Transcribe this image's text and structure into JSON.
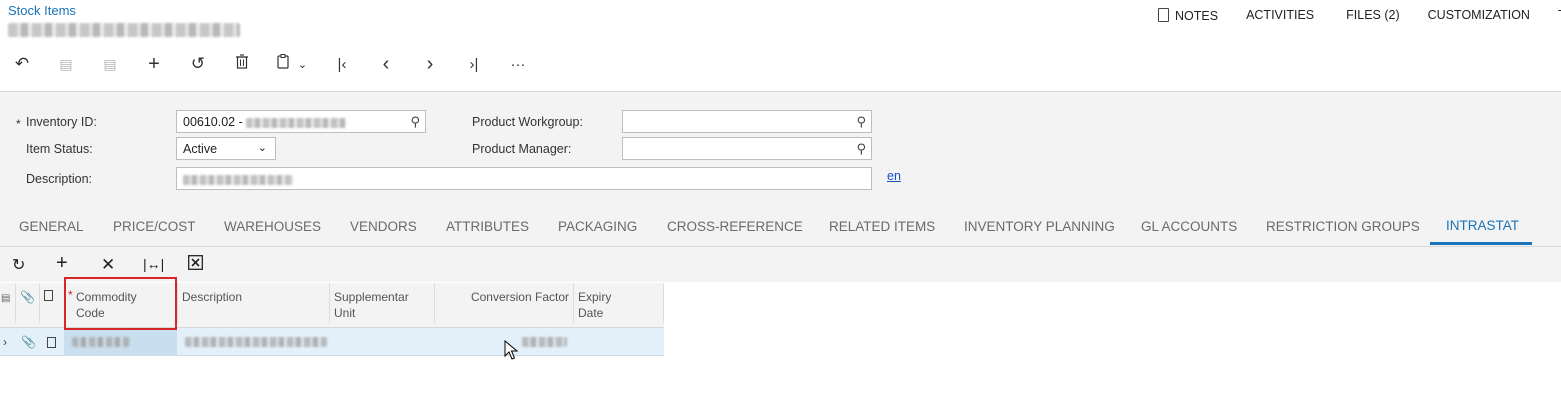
{
  "header": {
    "screen_title": "Stock Items",
    "links": [
      "NOTES",
      "ACTIVITIES",
      "FILES (2)",
      "CUSTOMIZATION",
      "TO"
    ]
  },
  "toolbar": {
    "back": "↶",
    "cancel": "⟲",
    "save": "🖫",
    "add": "+",
    "undo": "↶",
    "delete": "🗑",
    "copy": "⎘",
    "copy_arrow": "⌄",
    "first": "|<",
    "prev": "<",
    "next": ">",
    "last": ">|",
    "more": "···"
  },
  "form": {
    "inventory_id_label": "Inventory ID:",
    "inventory_id_value": "00610.02 -",
    "item_status_label": "Item Status:",
    "item_status_value": "Active",
    "description_label": "Description:",
    "product_workgroup_label": "Product Workgroup:",
    "product_manager_label": "Product Manager:",
    "language_link": "en",
    "required_mark": "*"
  },
  "tabs": [
    {
      "label": "GENERAL"
    },
    {
      "label": "PRICE/COST"
    },
    {
      "label": "WAREHOUSES"
    },
    {
      "label": "VENDORS"
    },
    {
      "label": "ATTRIBUTES"
    },
    {
      "label": "PACKAGING"
    },
    {
      "label": "CROSS-REFERENCE"
    },
    {
      "label": "RELATED ITEMS"
    },
    {
      "label": "INVENTORY PLANNING"
    },
    {
      "label": "GL ACCOUNTS"
    },
    {
      "label": "RESTRICTION GROUPS"
    },
    {
      "label": "INTRASTAT"
    }
  ],
  "active_tab": "INTRASTAT",
  "grid": {
    "columns": {
      "commodity_code": "Commodity Code",
      "description": "Description",
      "supplementary_unit": "Supplementar Unit",
      "conversion_factor": "Conversion Factor",
      "expiry_date": "Expiry Date"
    },
    "required_mark": "*"
  },
  "colors": {
    "accent": "#1a73b8",
    "highlight_border": "#d62626",
    "row_selected": "#e3f0fa"
  }
}
